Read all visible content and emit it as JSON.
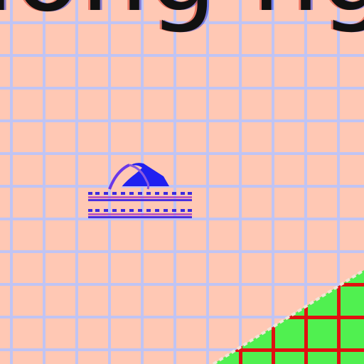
{
  "zoomed_view": {
    "text_fragment": "long ng",
    "background_color": "#ffc8b4",
    "grid_color": "#c0c4f4",
    "wedge_fill_color": "#50f050",
    "wedge_grid_color": "#e01010"
  },
  "icons": {
    "tray_icon": "weather-sunrise-icon"
  }
}
